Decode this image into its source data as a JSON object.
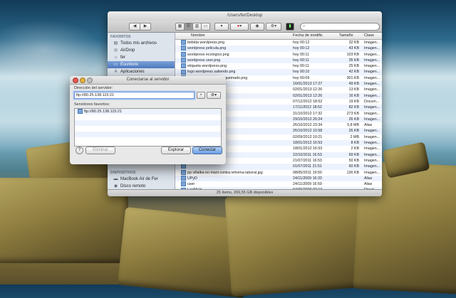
{
  "finder": {
    "title": "/Users/fer/Desktop",
    "status": "25 ítems, 269,55 GB disponibles",
    "sidebar": {
      "favorites_header": "FAVORITOS",
      "favorites": [
        "Todos mis archivos",
        "AirDrop",
        "fer",
        "Escritorio",
        "Aplicaciones"
      ],
      "devices_header": "DISPOSITIVOS",
      "devices": [
        "MacBook Air de Fer",
        "Disco remoto"
      ]
    },
    "columns": {
      "name": "Nombre",
      "date": "Fecha de modific",
      "size": "Tamaño",
      "kind": "Clase"
    },
    "rows": [
      {
        "name": "bebida wordpress.png",
        "date": "hoy 00:12",
        "size": "32 KB",
        "kind": "Imagen..."
      },
      {
        "name": "wordpress pelicula.png",
        "date": "hoy 00:12",
        "size": "43 KB",
        "kind": "Imagen..."
      },
      {
        "name": "wordpress ecologico.png",
        "date": "hoy 00:11",
        "size": "103 KB",
        "kind": "Imagen..."
      },
      {
        "name": "wordpress user.png",
        "date": "hoy 00:11",
        "size": "35 KB",
        "kind": "Imagen..."
      },
      {
        "name": "etiqueta wordpress.png",
        "date": "hoy 00:11",
        "size": "25 KB",
        "kind": "Imagen..."
      },
      {
        "name": "logo wordpress saliendo.png",
        "date": "hoy 00:10",
        "size": "42 KB",
        "kind": "Imagen..."
      },
      {
        "name": "logo wordpress papel quemado.png",
        "date": "hoy 00:09",
        "size": "301 KB",
        "kind": "Imagen..."
      },
      {
        "name": "",
        "date": "16/01/2013 17:27",
        "size": "49 KB",
        "kind": "Imagen..."
      },
      {
        "name": "",
        "date": "02/01/2013 12:26",
        "size": "13 KB",
        "kind": "Imagen..."
      },
      {
        "name": "",
        "date": "02/01/2013 12:26",
        "size": "16 KB",
        "kind": "Imagen..."
      },
      {
        "name": "",
        "date": "07/12/2012 18:52",
        "size": "19 KB",
        "kind": "Docum..."
      },
      {
        "name": "",
        "date": "17/11/2012 18:52",
        "size": "82 KB",
        "kind": "Imagen..."
      },
      {
        "name": "",
        "date": "31/10/2012 17:32",
        "size": "273 KB",
        "kind": "Imagen..."
      },
      {
        "name": "",
        "date": "29/10/2012 20:24",
        "size": "26 KB",
        "kind": "Imagen..."
      },
      {
        "name": "",
        "date": "26/10/2012 23:34",
        "size": "5,8 MB",
        "kind": "Alias"
      },
      {
        "name": "",
        "date": "26/10/2012 10:58",
        "size": "26 KB",
        "kind": "Imagen..."
      },
      {
        "name": "",
        "date": "02/09/2012 10:21",
        "size": "2 MB",
        "kind": "Imagen..."
      },
      {
        "name": "",
        "date": "18/01/2012 16:53",
        "size": "8 KB",
        "kind": "Imagen..."
      },
      {
        "name": "",
        "date": "18/01/2012 16:53",
        "size": "2 KB",
        "kind": "Imagen..."
      },
      {
        "name": "",
        "date": "22/10/2011 16:53",
        "size": "69 KB",
        "kind": "Imagen..."
      },
      {
        "name": "",
        "date": "21/07/2011 16:53",
        "size": "50 KB",
        "kind": "Imagen..."
      },
      {
        "name": "",
        "date": "01/07/2011 21:51",
        "size": "60 KB",
        "kind": "Imagen..."
      },
      {
        "name": "pp villalba en mani contra reforma laboral.jpg",
        "date": "08/05/2011 19:50",
        "size": "136 KB",
        "kind": "Imagen..."
      },
      {
        "name": "UPyD",
        "date": "24/11/2009 16:33",
        "size": "",
        "kind": "Alias"
      },
      {
        "name": "user",
        "date": "24/11/2009 16:59",
        "size": "",
        "kind": "Alias"
      },
      {
        "name": "LogMeIn",
        "date": "04/09/2009 02:13",
        "size": "",
        "kind": "Direct..."
      }
    ]
  },
  "dialog": {
    "title": "Conectarse al servidor",
    "server_label": "Dirección del servidor:",
    "server_value": "ftp://80.25.138.115:21",
    "add_label": "+",
    "options_label": "⚙▾",
    "favorites_label": "Servidores favoritos:",
    "favorites": [
      "ftp://80.25.138.115:21"
    ],
    "help_label": "?",
    "remove_label": "Eliminar",
    "browse_label": "Explorar",
    "connect_label": "Conectar"
  }
}
